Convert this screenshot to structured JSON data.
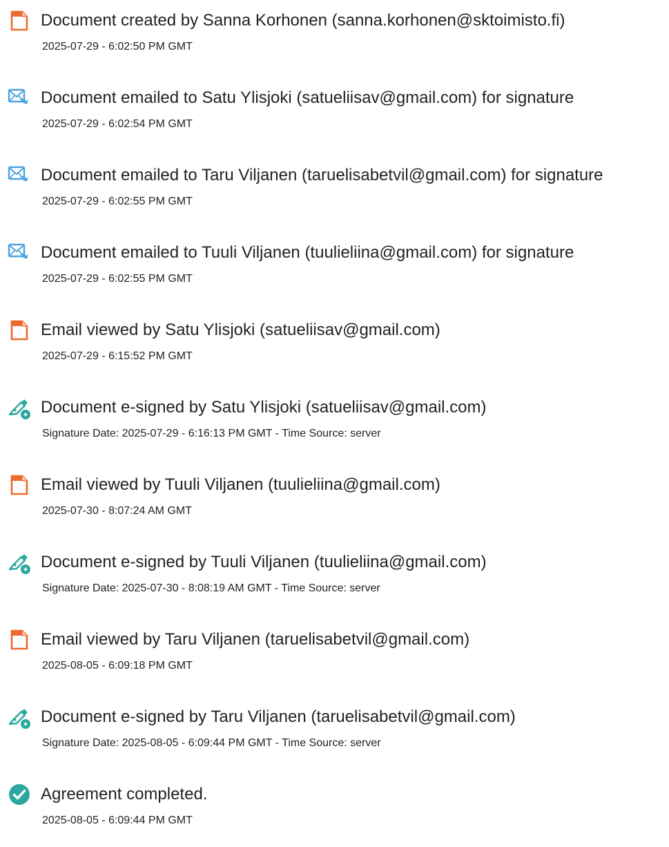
{
  "colors": {
    "document_icon": "#ec6a2f",
    "email_icon": "#4aa3df",
    "signed_icon": "#2ba99f",
    "completed_icon": "#2ba99f",
    "text": "#222222"
  },
  "events": [
    {
      "icon": "document-icon",
      "title": "Document created by Sanna Korhonen (sanna.korhonen@sktoimisto.fi)",
      "timestamp": "2025-07-29 - 6:02:50 PM GMT"
    },
    {
      "icon": "email-sent-icon",
      "title": "Document emailed to Satu Ylisjoki (satueliisav@gmail.com) for signature",
      "timestamp": "2025-07-29 - 6:02:54 PM GMT"
    },
    {
      "icon": "email-sent-icon",
      "title": "Document emailed to Taru Viljanen (taruelisabetvil@gmail.com) for signature",
      "timestamp": "2025-07-29 - 6:02:55 PM GMT"
    },
    {
      "icon": "email-sent-icon",
      "title": "Document emailed to Tuuli Viljanen (tuulieliina@gmail.com) for signature",
      "timestamp": "2025-07-29 - 6:02:55 PM GMT"
    },
    {
      "icon": "document-icon",
      "title": "Email viewed by Satu Ylisjoki (satueliisav@gmail.com)",
      "timestamp": "2025-07-29 - 6:15:52 PM GMT"
    },
    {
      "icon": "e-sign-pen-icon",
      "title": "Document e-signed by Satu Ylisjoki (satueliisav@gmail.com)",
      "timestamp": "Signature Date: 2025-07-29 - 6:16:13 PM GMT - Time Source: server"
    },
    {
      "icon": "document-icon",
      "title": "Email viewed by Tuuli Viljanen (tuulieliina@gmail.com)",
      "timestamp": "2025-07-30 - 8:07:24 AM GMT"
    },
    {
      "icon": "e-sign-pen-icon",
      "title": "Document e-signed by Tuuli Viljanen (tuulieliina@gmail.com)",
      "timestamp": "Signature Date: 2025-07-30 - 8:08:19 AM GMT - Time Source: server"
    },
    {
      "icon": "document-icon",
      "title": "Email viewed by Taru Viljanen (taruelisabetvil@gmail.com)",
      "timestamp": "2025-08-05 - 6:09:18 PM GMT"
    },
    {
      "icon": "e-sign-pen-icon",
      "title": "Document e-signed by Taru Viljanen (taruelisabetvil@gmail.com)",
      "timestamp": "Signature Date: 2025-08-05 - 6:09:44 PM GMT - Time Source: server"
    },
    {
      "icon": "checkmark-circle-icon",
      "title": "Agreement completed.",
      "timestamp": "2025-08-05 - 6:09:44 PM GMT"
    }
  ]
}
